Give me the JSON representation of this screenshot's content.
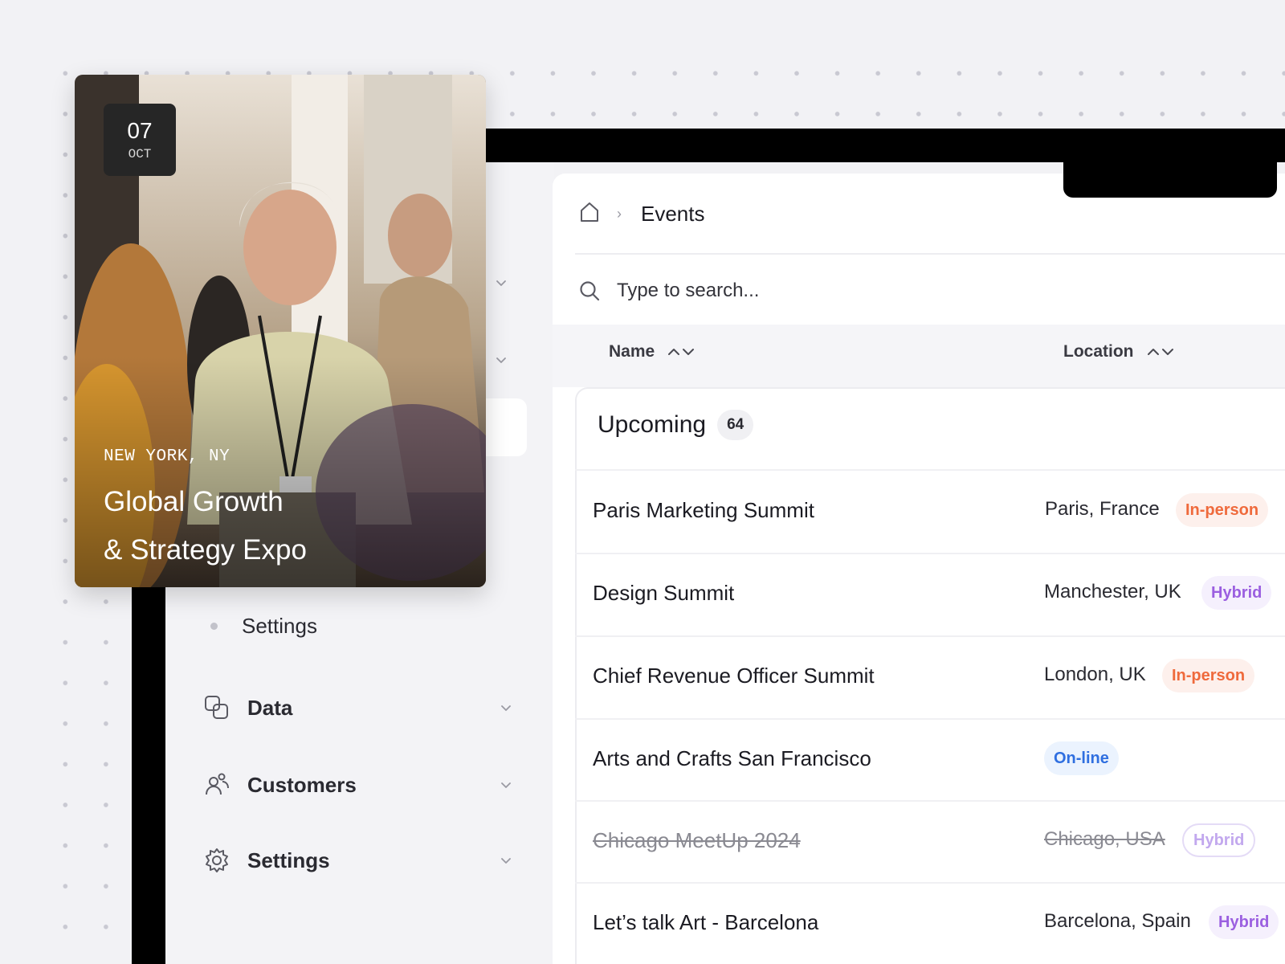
{
  "event_card": {
    "day": "07",
    "month": "OCT",
    "city": "NEW YORK, NY",
    "title_line1": "Global Growth",
    "title_line2": "& Strategy Expo"
  },
  "sidebar": {
    "sub_item": "Settings",
    "items": [
      {
        "label": "Data",
        "icon": "data-icon"
      },
      {
        "label": "Customers",
        "icon": "customers-icon"
      },
      {
        "label": "Settings",
        "icon": "gear-icon"
      }
    ]
  },
  "breadcrumb": {
    "current": "Events"
  },
  "search": {
    "placeholder": "Type to search..."
  },
  "table": {
    "columns": [
      "Name",
      "Location"
    ],
    "group": {
      "title": "Upcoming",
      "count": "64"
    },
    "rows": [
      {
        "name": "Paris Marketing Summit",
        "location": "Paris, France",
        "type": "In-person"
      },
      {
        "name": "Design Summit",
        "location": "Manchester, UK",
        "type": "Hybrid"
      },
      {
        "name": "Chief Revenue Officer Summit",
        "location": "London, UK",
        "type": "In-person"
      },
      {
        "name": "Arts and Crafts San Francisco",
        "location": "",
        "type": "On-line"
      },
      {
        "name": "Chicago MeetUp 2024",
        "location": "Chicago, USA",
        "type": "Hybrid",
        "cancelled": true
      },
      {
        "name": "Let’s talk Art - Barcelona",
        "location": "Barcelona, Spain",
        "type": "Hybrid"
      }
    ]
  },
  "colors": {
    "in_person": "#ef6a3c",
    "hybrid": "#9b5fe0",
    "online": "#2f6fe0"
  }
}
